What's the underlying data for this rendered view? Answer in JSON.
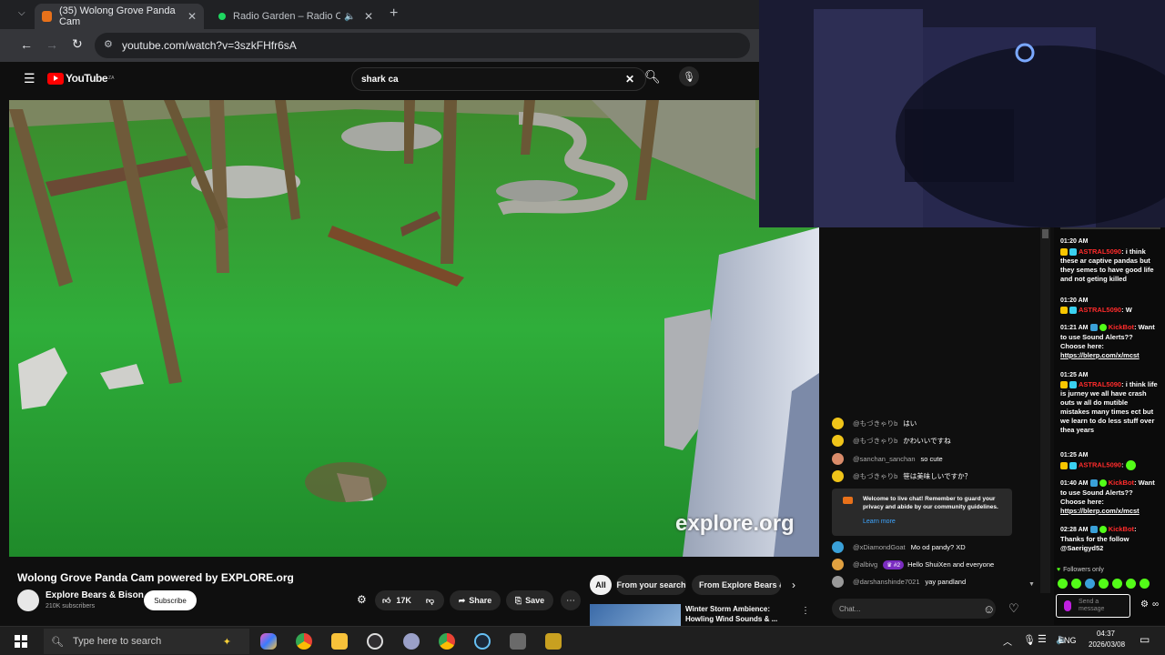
{
  "browser": {
    "tabs": [
      {
        "title": "(35) Wolong Grove Panda Cam",
        "favicon_color": "#e8711a"
      },
      {
        "title": "Radio Garden – Radio Oran",
        "favicon_color": "#1ed760"
      }
    ],
    "url": "youtube.com/watch?v=3szkFHfr6sA"
  },
  "youtube": {
    "logo_text": "YouTube",
    "logo_sup": "ZA",
    "search_value": "shark ca",
    "video_watermark": "explore.org",
    "video_title": "Wolong Grove Panda Cam powered by EXPLORE.org",
    "channel_name": "Explore Bears & Bison",
    "subscribers": "210K subscribers",
    "subscribe_label": "Subscribe",
    "like_count": "17K",
    "share_label": "Share",
    "save_label": "Save",
    "filters": [
      "All",
      "From your search",
      "From Explore Bears & B"
    ],
    "rec_title_1": "Winter Storm Ambience:",
    "rec_title_2": "Howling Wind Sounds & ..."
  },
  "yt_chat": {
    "messages": [
      {
        "user": "@もづきゃりb",
        "msg": "はい",
        "color": "#f0c419"
      },
      {
        "user": "@もづきゃりb",
        "msg": "かわいいですね",
        "color": "#f0c419"
      },
      {
        "user": "@sanchan_sanchan",
        "msg": "so cute",
        "color": "#d98b6a"
      },
      {
        "user": "@もづきゃりb",
        "msg": "笹は美味しいですか？",
        "color": "#f0c419"
      },
      {
        "user": "@xDiamondGoat",
        "msg": "Mo od pandy? XD",
        "color": "#3aa0d8"
      },
      {
        "user": "@albivg",
        "msg": "Hello ShuiXen and everyone",
        "color": "#e0a040",
        "badge": "#2"
      },
      {
        "user": "@darshanshinde7021",
        "msg": "yay pandland",
        "color": "#999999"
      }
    ],
    "notice": "Welcome to live chat! Remember to guard your privacy and abide by our community guidelines.",
    "learn_more": "Learn more",
    "input_placeholder": "Chat..."
  },
  "kick_chat": {
    "top_time": "01:20 AM",
    "entries": [
      {
        "time": "",
        "user": "ASTRAL5090",
        "msg": ": i think these ar captive pandas but they semes to have good life and not geting killed"
      },
      {
        "time": "01:20 AM",
        "user": "ASTRAL5090",
        "msg": ": W"
      },
      {
        "time": "01:21 AM",
        "user": "KickBot",
        "msg": ": Want to use Sound Alerts?? Choose here:",
        "link": "https://blerp.com/x/mcst"
      },
      {
        "time": "01:25 AM",
        "user": "ASTRAL5090",
        "msg": ": i think life is jurney we all have crash outs w all do mutible mistakes many times ect but we learn to do less stuff over thea years"
      },
      {
        "time": "01:25 AM",
        "user": "ASTRAL5090",
        "msg": ":"
      },
      {
        "time": "01:40 AM",
        "user": "KickBot",
        "msg": ": Want to use Sound Alerts?? Choose here:",
        "link": "https://blerp.com/x/mcst"
      },
      {
        "time": "02:28 AM",
        "user": "KickBot",
        "msg": ": Thanks for the follow @Saerigyd52"
      }
    ],
    "followers_only": "Followers only",
    "send_placeholder": "Send a message"
  },
  "taskbar": {
    "search_placeholder": "Type here to search",
    "lang": "ENG",
    "time": "04:37",
    "date": "2026/03/08"
  },
  "colors": {
    "astral": "#ff2b2b",
    "kickbot": "#ff2b2b",
    "kick_green": "#53fc18",
    "grass": "#2fa83a"
  }
}
